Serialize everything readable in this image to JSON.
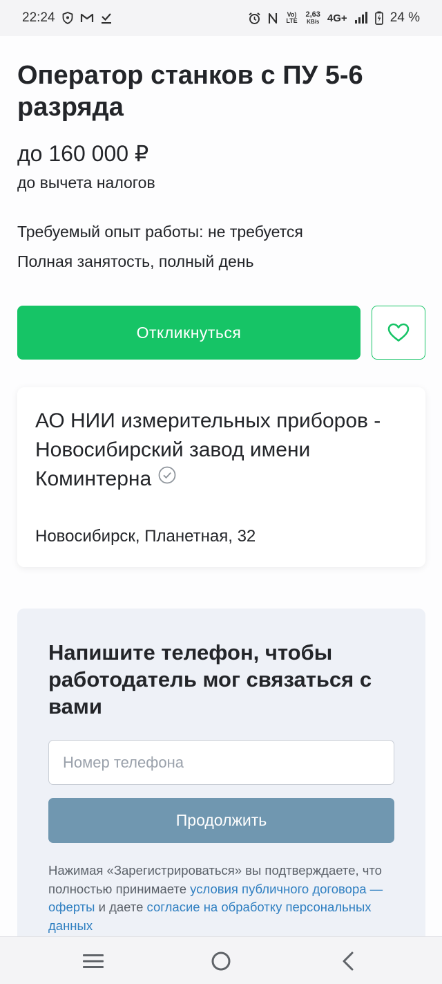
{
  "status_bar": {
    "time": "22:24",
    "left_icons": [
      "shield-icon",
      "gmail-icon",
      "download-done-icon"
    ],
    "right_icons": [
      "alarm-icon",
      "nfc-icon",
      "volte-icon",
      "speed-icon",
      "signal-icon",
      "battery-icon"
    ],
    "volte_text": "Vo) LTE",
    "speed_value": "2,63",
    "speed_unit": "KB/s",
    "network": "4G+",
    "battery": "24 %"
  },
  "vacancy": {
    "title": "Оператор станков с ПУ 5-6 разряда",
    "salary": "до 160 000 ₽",
    "salary_note": "до вычета налогов",
    "experience": "Требуемый опыт работы: не требуется",
    "employment": "Полная занятость, полный день"
  },
  "actions": {
    "respond_label": "Откликнуться",
    "favorite_icon": "heart-icon"
  },
  "company": {
    "name": "АО НИИ измерительных приборов - Новосибирский завод имени Коминтерна",
    "verified_icon": "verified-check-icon",
    "address": "Новосибирск, Планетная, 32"
  },
  "phone_form": {
    "title": "Напишите телефон, чтобы работодатель мог связаться с вами",
    "input_placeholder": "Номер телефона",
    "input_value": "",
    "continue_label": "Продолжить",
    "legal_part1": "Нажимая «Зарегистрироваться» вы подтверждаете, что полностью принимаете ",
    "legal_link1": "условия публичного договора — оферты",
    "legal_part2": " и даете ",
    "legal_link2": "согласие на обработку персональных данных"
  },
  "nav": {
    "items": [
      "menu-icon",
      "home-icon",
      "back-icon"
    ]
  },
  "colors": {
    "accent_green": "#16c466",
    "continue_button": "#7097b0",
    "link": "#2f7fc1",
    "form_background": "#eef1f7"
  }
}
